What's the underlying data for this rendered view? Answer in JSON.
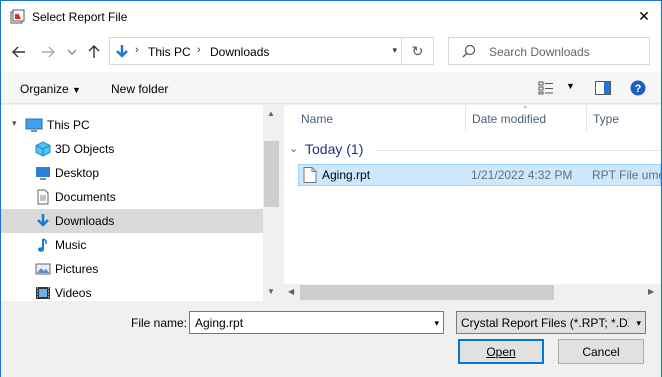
{
  "window": {
    "title": "Select Report File",
    "close_glyph": "✕"
  },
  "address": {
    "crumbs": [
      "This PC",
      "Downloads"
    ],
    "search_placeholder": "Search Downloads"
  },
  "command_bar": {
    "organize": "Organize",
    "new_folder": "New folder"
  },
  "nav_pane": {
    "items": [
      {
        "label": "This PC",
        "icon": "computer-icon"
      },
      {
        "label": "3D Objects",
        "icon": "3d-objects-icon"
      },
      {
        "label": "Desktop",
        "icon": "desktop-icon"
      },
      {
        "label": "Documents",
        "icon": "documents-icon"
      },
      {
        "label": "Downloads",
        "icon": "downloads-icon",
        "selected": true
      },
      {
        "label": "Music",
        "icon": "music-icon"
      },
      {
        "label": "Pictures",
        "icon": "pictures-icon"
      },
      {
        "label": "Videos",
        "icon": "videos-icon"
      }
    ]
  },
  "file_list": {
    "columns": [
      "Name",
      "Date modified",
      "Type"
    ],
    "group_label": "Today (1)",
    "files": [
      {
        "name": "Aging.rpt",
        "date_modified": "1/21/2022 4:32 PM",
        "type": "RPT File ume"
      }
    ]
  },
  "bottom": {
    "file_name_label": "File name:",
    "file_name_value": "Aging.rpt",
    "filter_value": "Crystal Report Files (*.RPT; *.DX",
    "open_label": "Open",
    "cancel_label": "Cancel"
  },
  "colors": {
    "accent": "#0078d7",
    "selection": "#cce8ff",
    "group_text": "#1e3287",
    "border": "#1a6fd0"
  }
}
